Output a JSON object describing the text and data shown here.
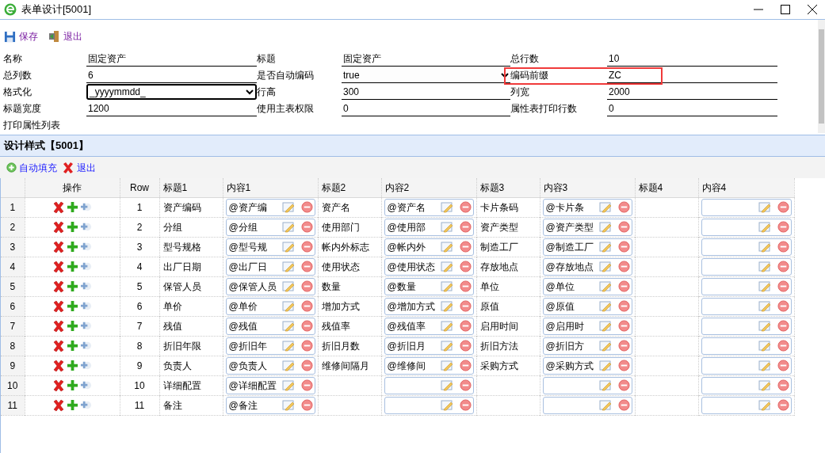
{
  "window": {
    "title": "表单设计[5001]"
  },
  "toolbar": [
    "保存",
    "退出"
  ],
  "form": {
    "fields": [
      {
        "label": "名称",
        "value": "固定资产",
        "kind": "text",
        "highlighted": false
      },
      {
        "label": "标题",
        "value": "固定资产",
        "kind": "text",
        "highlighted": false
      },
      {
        "label": "总行数",
        "value": "10",
        "kind": "text",
        "highlighted": false
      },
      {
        "label": "总列数",
        "value": "6",
        "kind": "text",
        "highlighted": false
      },
      {
        "label": "是否自动编码",
        "value": "true",
        "kind": "select",
        "focused": false,
        "highlighted": false
      },
      {
        "label": "编码前缀",
        "value": "ZC",
        "kind": "text",
        "highlighted": true
      },
      {
        "label": "格式化",
        "value": "_yyyymmdd_",
        "kind": "select",
        "focused": true,
        "highlighted": false
      },
      {
        "label": "行高",
        "value": "300",
        "kind": "text",
        "highlighted": false
      },
      {
        "label": "列宽",
        "value": "2000",
        "kind": "text",
        "highlighted": false
      },
      {
        "label": "标题宽度",
        "value": "1200",
        "kind": "text",
        "highlighted": false
      },
      {
        "label": "使用主表权限",
        "value": "0",
        "kind": "text",
        "highlighted": false
      },
      {
        "label": "属性表打印行数",
        "value": "0",
        "kind": "text",
        "highlighted": false
      },
      {
        "label": "打印属性列表",
        "kind": "label",
        "highlighted": false
      }
    ]
  },
  "panel": {
    "title": "设计样式【5001】",
    "toolbar": [
      "自动填充",
      "退出"
    ],
    "table": {
      "columns": [
        "操作",
        "Row",
        "标题1",
        "内容1",
        "标题2",
        "内容2",
        "标题3",
        "内容3",
        "标题4",
        "内容4"
      ],
      "rows": [
        {
          "num": "1",
          "row": "1",
          "pairs": [
            {
              "title": "资产编码",
              "content": "@资产编"
            },
            {
              "title": "资产名",
              "content": "@资产名"
            },
            {
              "title": "卡片条码",
              "content": "@卡片条"
            }
          ]
        },
        {
          "num": "2",
          "row": "2",
          "pairs": [
            {
              "title": "分组",
              "content": "@分组"
            },
            {
              "title": "使用部门",
              "content": "@使用部"
            },
            {
              "title": "资产类型",
              "content": "@资产类型"
            }
          ]
        },
        {
          "num": "3",
          "row": "3",
          "pairs": [
            {
              "title": "型号规格",
              "content": "@型号规"
            },
            {
              "title": "帐内外标志",
              "content": "@帐内外"
            },
            {
              "title": "制造工厂",
              "content": "@制造工厂"
            }
          ]
        },
        {
          "num": "4",
          "row": "4",
          "pairs": [
            {
              "title": "出厂日期",
              "content": "@出厂日"
            },
            {
              "title": "使用状态",
              "content": "@使用状态"
            },
            {
              "title": "存放地点",
              "content": "@存放地点"
            }
          ]
        },
        {
          "num": "5",
          "row": "5",
          "pairs": [
            {
              "title": "保管人员",
              "content": "@保管人员"
            },
            {
              "title": "数量",
              "content": "@数量"
            },
            {
              "title": "单位",
              "content": "@单位"
            }
          ]
        },
        {
          "num": "6",
          "row": "6",
          "pairs": [
            {
              "title": "单价",
              "content": "@单价"
            },
            {
              "title": "增加方式",
              "content": "@增加方式"
            },
            {
              "title": "原值",
              "content": "@原值"
            }
          ]
        },
        {
          "num": "7",
          "row": "7",
          "pairs": [
            {
              "title": "残值",
              "content": "@残值"
            },
            {
              "title": "残值率",
              "content": "@残值率"
            },
            {
              "title": "启用时间",
              "content": "@启用时"
            }
          ]
        },
        {
          "num": "8",
          "row": "8",
          "pairs": [
            {
              "title": "折旧年限",
              "content": "@折旧年"
            },
            {
              "title": "折旧月数",
              "content": "@折旧月"
            },
            {
              "title": "折旧方法",
              "content": "@折旧方"
            }
          ]
        },
        {
          "num": "9",
          "row": "9",
          "pairs": [
            {
              "title": "负责人",
              "content": "@负责人"
            },
            {
              "title": "维修间隔月",
              "content": "@维修间"
            },
            {
              "title": "采购方式",
              "content": "@采购方式"
            }
          ]
        },
        {
          "num": "10",
          "row": "10",
          "pairs": [
            {
              "title": "详细配置",
              "content": "@详细配置"
            }
          ]
        },
        {
          "num": "11",
          "row": "11",
          "pairs": [
            {
              "title": "备注",
              "content": "@备注"
            }
          ]
        }
      ]
    }
  }
}
